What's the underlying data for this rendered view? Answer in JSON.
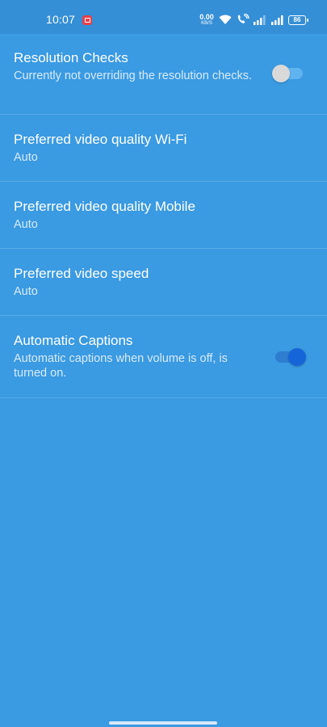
{
  "status_bar": {
    "time": "10:07",
    "net_speed_value": "0.00",
    "net_speed_unit": "KB/S",
    "battery": "86",
    "icons": [
      "screen-record-icon",
      "wifi-icon",
      "volte-icon",
      "signal-icon",
      "signal-icon",
      "battery-icon"
    ]
  },
  "settings": {
    "resolution": {
      "title": "Resolution Checks",
      "summary": "Currently not overriding the resolution checks.",
      "toggle_on": false
    },
    "wifi_quality": {
      "title": "Preferred video quality Wi-Fi",
      "summary": "Auto"
    },
    "mobile_quality": {
      "title": "Preferred video quality Mobile",
      "summary": "Auto"
    },
    "speed": {
      "title": "Preferred video speed",
      "summary": "Auto"
    },
    "captions": {
      "title": "Automatic Captions",
      "summary": "Automatic captions when volume is off, is turned on.",
      "toggle_on": true
    }
  },
  "colors": {
    "background": "#3a9ae2",
    "status_bar": "#358fd6",
    "toggle_on_thumb": "#1565d8",
    "toggle_off_thumb": "#d9d9d9"
  }
}
